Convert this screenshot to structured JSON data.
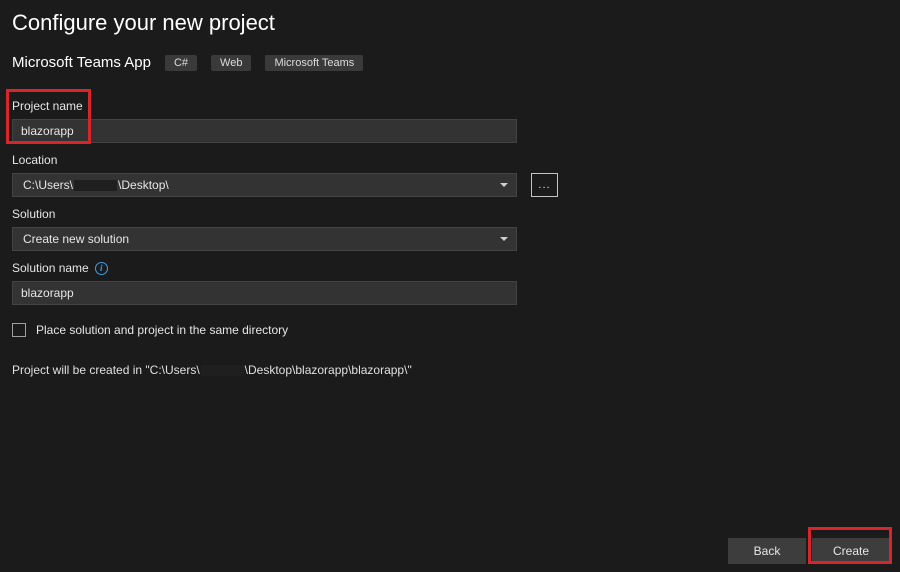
{
  "header": {
    "title": "Configure your new project"
  },
  "template": {
    "name": "Microsoft Teams App",
    "tags": [
      "C#",
      "Web",
      "Microsoft Teams"
    ]
  },
  "fields": {
    "projectName": {
      "label": "Project name",
      "value": "blazorapp"
    },
    "location": {
      "label": "Location",
      "prefix": "C:\\Users\\",
      "suffix": "\\Desktop\\",
      "browse": "..."
    },
    "solution": {
      "label": "Solution",
      "value": "Create new solution"
    },
    "solutionName": {
      "label": "Solution name",
      "value": "blazorapp"
    },
    "sameDirectory": {
      "label": "Place solution and project in the same directory",
      "checked": false
    }
  },
  "status": {
    "prefix": "Project will be created in \"C:\\Users\\",
    "suffix": "\\Desktop\\blazorapp\\blazorapp\\\""
  },
  "footer": {
    "back": "Back",
    "create": "Create"
  }
}
